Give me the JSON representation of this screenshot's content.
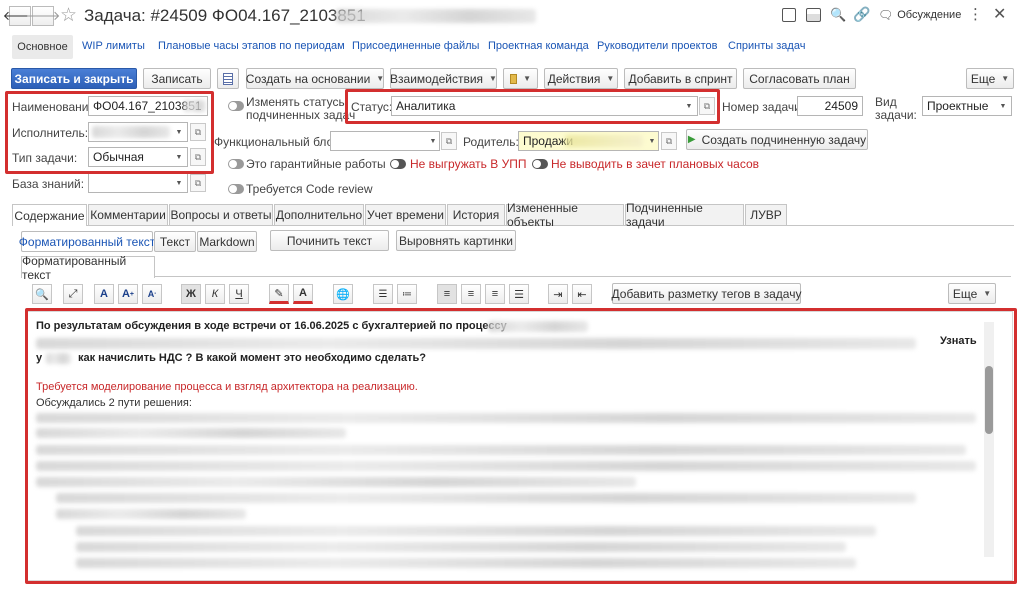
{
  "window": {
    "title": "Задача: #24509 ФО04.167_2103851",
    "discussion": "Обсуждение"
  },
  "nav": {
    "tabs": [
      "Основное",
      "WIP лимиты",
      "Плановые часы этапов по периодам",
      "Присоединенные файлы",
      "Проектная команда",
      "Руководители проектов",
      "Спринты задач"
    ]
  },
  "toolbar": {
    "save_close": "Записать и закрыть",
    "save": "Записать",
    "create_based": "Создать на основании",
    "interactions": "Взаимодействия",
    "actions": "Действия",
    "add_sprint": "Добавить в спринт",
    "approve_plan": "Согласовать план",
    "more": "Еще"
  },
  "form": {
    "name_label": "Наименование:",
    "name_value": "ФО04.167_2103851",
    "executor_label": "Исполнитель:",
    "task_type_label": "Тип задачи:",
    "task_type_value": "Обычная",
    "kb_label": "База знаний:",
    "change_status_label_1": "Изменять статусы",
    "change_status_label_2": "подчиненных задач",
    "status_label": "Статус:",
    "status_value": "Аналитика",
    "task_no_label": "Номер задачи:",
    "task_no_value": "24509",
    "kind_label_1": "Вид",
    "kind_label_2": "задачи:",
    "kind_value": "Проектные",
    "func_block_label": "Функциональный блок:",
    "parent_label": "Родитель:",
    "parent_value": "Продажи",
    "create_subtask": "Создать подчиненную задачу",
    "warranty_label": "Это гарантийные работы",
    "no_upload_label": "Не выгружать В УПП",
    "no_plan_label": "Не выводить в зачет плановых часов",
    "code_review_label": "Требуется Code review"
  },
  "content_tabs": [
    "Содержание",
    "Комментарии",
    "Вопросы и ответы",
    "Дополнительно",
    "Учет времени",
    "История",
    "Измененные объекты",
    "Подчиненные задачи",
    "ЛУВР"
  ],
  "format_tabs": [
    "Форматированный текст",
    "Текст",
    "Markdown"
  ],
  "fix_text": "Починить текст",
  "align_images": "Выровнять картинки",
  "editor_tab": "Форматированный текст",
  "editor_toolbar": {
    "bold": "Ж",
    "italic": "К",
    "underline": "Ч",
    "add_tags": "Добавить разметку тегов в задачу",
    "more": "Еще"
  },
  "editor": {
    "line1": "По результатам обсуждения в ходе встречи от 16.06.2025 с бухгалтерией по процессу",
    "line2_end": "Узнать",
    "line3_start": "у",
    "line3": "как начислить НДС ? В какой момент это необходимо сделать?",
    "red_line": "Требуется моделирование процесса и взгляд архитектора на реализацию.",
    "line5": "Обсуждались 2 пути решения:"
  }
}
